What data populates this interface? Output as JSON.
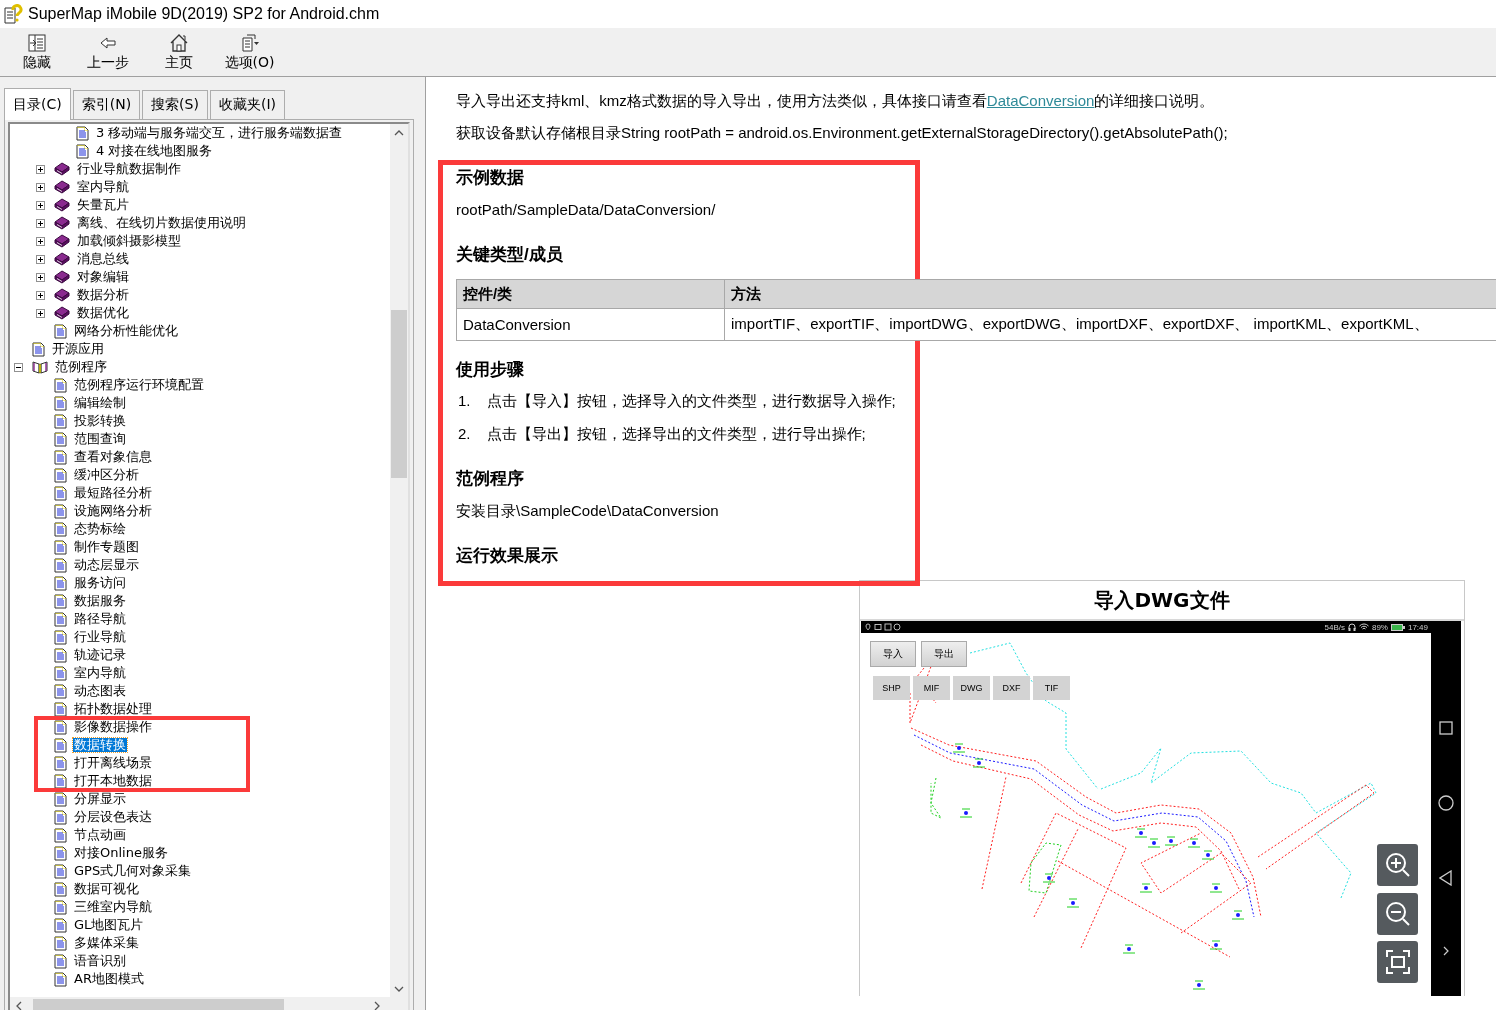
{
  "window": {
    "title": "SuperMap iMobile 9D(2019) SP2 for Android.chm"
  },
  "toolbar": [
    {
      "kind": "hide",
      "label": "隐藏"
    },
    {
      "kind": "back",
      "label": "上一步"
    },
    {
      "kind": "home",
      "label": "主页"
    },
    {
      "kind": "options",
      "label": "选项(O)"
    }
  ],
  "tabs": [
    {
      "label": "目录(C)",
      "selected": true
    },
    {
      "label": "索引(N)",
      "selected": false
    },
    {
      "label": "搜索(S)",
      "selected": false
    },
    {
      "label": "收藏夹(I)",
      "selected": false
    }
  ],
  "tree": [
    {
      "children": [
        {
          "children": [
            {
              "kind": "page",
              "label": "3 移动端与服务端交互，进行服务端数据查",
              "selected": false
            },
            {
              "kind": "page",
              "label": "4 对接在线地图服务",
              "selected": false
            }
          ]
        },
        {
          "kind": "book",
          "label": "行业导航数据制作",
          "expanded": false,
          "selected": false
        },
        {
          "kind": "book",
          "label": "室内导航",
          "expanded": false,
          "selected": false
        },
        {
          "kind": "book",
          "label": "矢量瓦片",
          "expanded": false,
          "selected": false
        },
        {
          "kind": "book",
          "label": "离线、在线切片数据使用说明",
          "expanded": false,
          "selected": false
        },
        {
          "kind": "book",
          "label": "加载倾斜摄影模型",
          "expanded": false,
          "selected": false
        },
        {
          "kind": "book",
          "label": "消息总线",
          "expanded": false,
          "selected": false
        },
        {
          "kind": "book",
          "label": "对象编辑",
          "expanded": false,
          "selected": false
        },
        {
          "kind": "book",
          "label": "数据分析",
          "expanded": false,
          "selected": false
        },
        {
          "kind": "book",
          "label": "数据优化",
          "expanded": false,
          "selected": false
        },
        {
          "kind": "page",
          "label": "网络分析性能优化",
          "selected": false
        }
      ]
    },
    {
      "kind": "page",
      "label": "开源应用",
      "selected": false
    },
    {
      "kind": "book",
      "label": "范例程序",
      "expanded": true,
      "selected": false,
      "children": [
        {
          "kind": "page",
          "label": "范例程序运行环境配置",
          "selected": false
        },
        {
          "kind": "page",
          "label": "编辑绘制",
          "selected": false
        },
        {
          "kind": "page",
          "label": "投影转换",
          "selected": false
        },
        {
          "kind": "page",
          "label": "范围查询",
          "selected": false
        },
        {
          "kind": "page",
          "label": "查看对象信息",
          "selected": false
        },
        {
          "kind": "page",
          "label": "缓冲区分析",
          "selected": false
        },
        {
          "kind": "page",
          "label": "最短路径分析",
          "selected": false
        },
        {
          "kind": "page",
          "label": "设施网络分析",
          "selected": false
        },
        {
          "kind": "page",
          "label": "态势标绘",
          "selected": false
        },
        {
          "kind": "page",
          "label": "制作专题图",
          "selected": false
        },
        {
          "kind": "page",
          "label": "动态层显示",
          "selected": false
        },
        {
          "kind": "page",
          "label": "服务访问",
          "selected": false
        },
        {
          "kind": "page",
          "label": "数据服务",
          "selected": false
        },
        {
          "kind": "page",
          "label": "路径导航",
          "selected": false
        },
        {
          "kind": "page",
          "label": "行业导航",
          "selected": false
        },
        {
          "kind": "page",
          "label": "轨迹记录",
          "selected": false
        },
        {
          "kind": "page",
          "label": "室内导航",
          "selected": false
        },
        {
          "kind": "page",
          "label": "动态图表",
          "selected": false
        },
        {
          "kind": "page",
          "label": "拓扑数据处理",
          "selected": false
        },
        {
          "kind": "page",
          "label": "影像数据操作",
          "selected": false
        },
        {
          "kind": "page",
          "label": "数据转换",
          "selected": true
        },
        {
          "kind": "page",
          "label": "打开离线场景",
          "selected": false
        },
        {
          "kind": "page",
          "label": "打开本地数据",
          "selected": false
        },
        {
          "kind": "page",
          "label": "分屏显示",
          "selected": false
        },
        {
          "kind": "page",
          "label": "分层设色表达",
          "selected": false
        },
        {
          "kind": "page",
          "label": "节点动画",
          "selected": false
        },
        {
          "kind": "page",
          "label": "对接Online服务",
          "selected": false
        },
        {
          "kind": "page",
          "label": "GPS式几何对象采集",
          "selected": false
        },
        {
          "kind": "page",
          "label": "数据可视化",
          "selected": false
        },
        {
          "kind": "page",
          "label": "三维室内导航",
          "selected": false
        },
        {
          "kind": "page",
          "label": "GL地图瓦片",
          "selected": false
        },
        {
          "kind": "page",
          "label": "多媒体采集",
          "selected": false
        },
        {
          "kind": "page",
          "label": "语音识别",
          "selected": false
        },
        {
          "kind": "page",
          "label": "AR地图模式",
          "selected": false
        }
      ]
    }
  ],
  "article": [
    {
      "kind": "link_paragraph",
      "before": "导入导出还支持kml、kmz格式数据的导入导出，使用方法类似，具体接口请查看",
      "link": "DataConversion",
      "after": "的详细接口说明。"
    },
    {
      "kind": "paragraph",
      "text": "获取设备默认存储根目录String rootPath = android.os.Environment.getExternalStorageDirectory().getAbsolutePath();"
    },
    {
      "kind": "heading",
      "text": "示例数据"
    },
    {
      "kind": "paragraph",
      "text": "rootPath/SampleData/DataConversion/"
    },
    {
      "kind": "heading",
      "text": "关键类型/成员"
    },
    {
      "kind": "table",
      "columns": [
        "控件/类",
        "方法"
      ],
      "rows": [
        [
          "DataConversion",
          "importTIF、exportTIF、importDWG、exportDWG、importDXF、exportDXF、 importKML、exportKML、"
        ]
      ]
    },
    {
      "kind": "heading",
      "text": "使用步骤"
    },
    {
      "kind": "steps",
      "items": [
        {
          "number": "1.",
          "text": "点击【导入】按钮，选择导入的文件类型，进行数据导入操作;"
        },
        {
          "number": "2.",
          "text": "点击【导出】按钮，选择导出的文件类型，进行导出操作;"
        }
      ]
    },
    {
      "kind": "heading",
      "text": "范例程序"
    },
    {
      "kind": "paragraph",
      "text": "安装目录\\SampleCode\\DataConversion"
    },
    {
      "kind": "heading",
      "text": "运行效果展示"
    },
    {
      "kind": "figure",
      "caption": "导入DWG文件",
      "status": {
        "speed": "54B/s",
        "battery": "89%",
        "time": "17:49"
      },
      "action_buttons": [
        "导入",
        "导出"
      ],
      "format_buttons": [
        "SHP",
        "MIF",
        "DWG",
        "DXF",
        "TIF"
      ]
    }
  ]
}
